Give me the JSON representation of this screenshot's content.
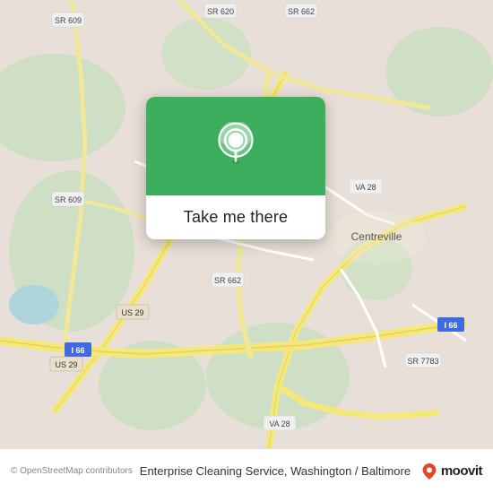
{
  "map": {
    "alt": "Map of Centreville, Virginia area showing Enterprise Cleaning Service location",
    "callout": {
      "button_label": "Take me there"
    }
  },
  "bottom_bar": {
    "copyright": "© OpenStreetMap contributors",
    "business_name": "Enterprise Cleaning Service, Washington / Baltimore",
    "moovit_label": "moovit"
  },
  "icons": {
    "pin": "location-pin-icon",
    "moovit_pin": "moovit-pin-icon"
  },
  "colors": {
    "map_bg": "#e8e0d8",
    "road_yellow": "#f5e87a",
    "road_white": "#ffffff",
    "green_area": "#c8dfc0",
    "water": "#aad3df",
    "callout_green": "#3cae5e",
    "text_dark": "#222222",
    "text_muted": "#888888"
  }
}
